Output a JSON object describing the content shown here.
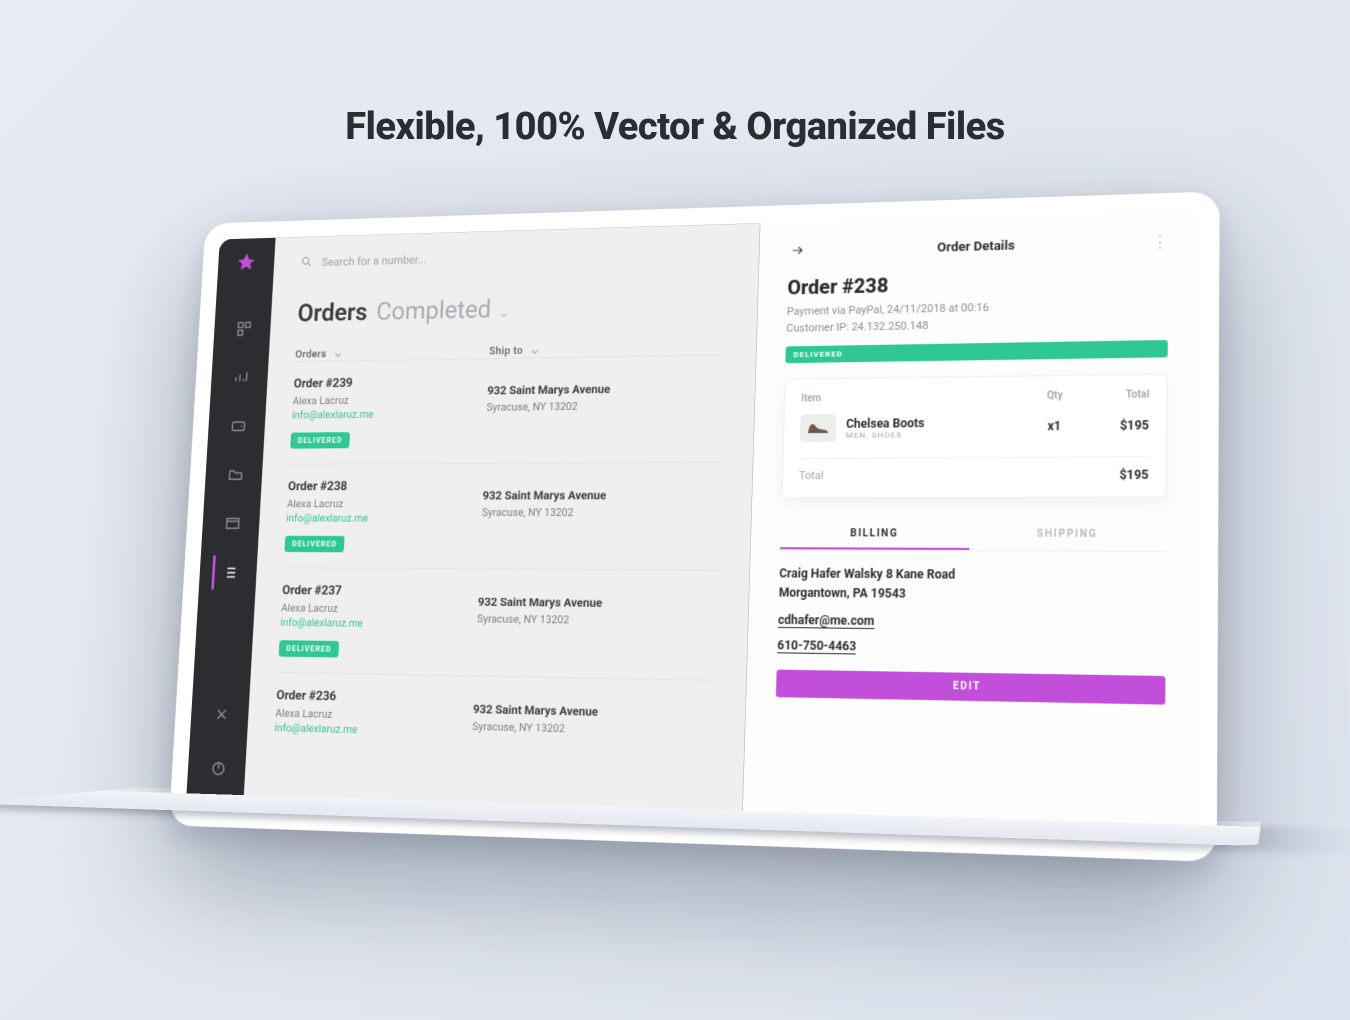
{
  "promo": {
    "title": "Flexible, 100% Vector & Organized Files"
  },
  "search": {
    "placeholder": "Search for a number..."
  },
  "orders_page": {
    "title": "Orders",
    "filter": "Completed",
    "columns": {
      "order": "Orders",
      "ship": "Ship to"
    },
    "rows": [
      {
        "id": "Order #239",
        "customer": "Alexa Lacruz",
        "email": "info@alexlaruz.me",
        "status": "DELIVERED",
        "ship_line1": "932 Saint Marys Avenue",
        "ship_line2": "Syracuse, NY 13202"
      },
      {
        "id": "Order #238",
        "customer": "Alexa Lacruz",
        "email": "info@alexlaruz.me",
        "status": "DELIVERED",
        "ship_line1": "932 Saint Marys Avenue",
        "ship_line2": "Syracuse, NY 13202"
      },
      {
        "id": "Order #237",
        "customer": "Alexa Lacruz",
        "email": "info@alexlaruz.me",
        "status": "DELIVERED",
        "ship_line1": "932 Saint Marys Avenue",
        "ship_line2": "Syracuse, NY 13202"
      },
      {
        "id": "Order #236",
        "customer": "Alexa Lacruz",
        "email": "info@alexlaruz.me",
        "status": "DELIVERED",
        "ship_line1": "932 Saint Marys Avenue",
        "ship_line2": "Syracuse, NY 13202"
      }
    ]
  },
  "detail": {
    "panel_title": "Order Details",
    "heading": "Order #238",
    "payment_meta": "Payment via PayPal, 24/11/2018 at 00:16",
    "ip_meta": "Customer IP: 24.132.250.148",
    "status": "DELIVERED",
    "columns": {
      "item": "Item",
      "qty": "Qty",
      "total": "Total"
    },
    "item": {
      "name": "Chelsea Boots",
      "category": "MEN, SHOES",
      "qty": "x1",
      "price": "$195"
    },
    "total_label": "Total",
    "total_value": "$195",
    "tabs": {
      "billing": "BILLING",
      "shipping": "SHIPPING"
    },
    "billing": {
      "address_l1": "Craig Hafer Walsky 8 Kane Road",
      "address_l2": "Morgantown, PA 19543",
      "email": "cdhafer@me.com",
      "phone": "610-750-4463"
    },
    "edit_label": "EDIT"
  },
  "sidebar_icons": [
    "dashboard",
    "analytics",
    "wallet",
    "folder",
    "window",
    "list",
    "tools",
    "power"
  ]
}
